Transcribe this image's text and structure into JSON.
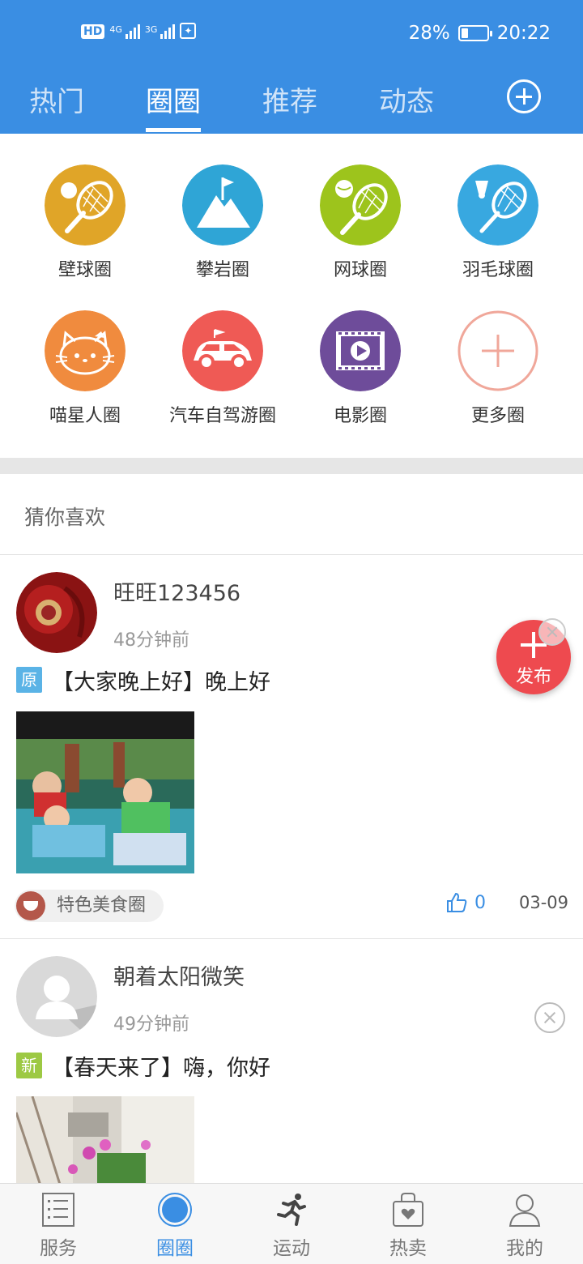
{
  "status_bar": {
    "hd": "HD",
    "net1": "4G",
    "net2": "3G",
    "battery": "28%",
    "battery_level": 0.28,
    "time": "20:22"
  },
  "top_tabs": [
    {
      "label": "热门",
      "active": false
    },
    {
      "label": "圈圈",
      "active": true
    },
    {
      "label": "推荐",
      "active": false
    },
    {
      "label": "动态",
      "active": false
    }
  ],
  "circles": [
    {
      "label": "壁球圈",
      "icon": "squash-racket-icon",
      "color": "#e0a528"
    },
    {
      "label": "攀岩圈",
      "icon": "mountain-flag-icon",
      "color": "#2fa5d6"
    },
    {
      "label": "网球圈",
      "icon": "tennis-racket-icon",
      "color": "#9dc41c"
    },
    {
      "label": "羽毛球圈",
      "icon": "badminton-racket-icon",
      "color": "#38a8e0"
    },
    {
      "label": "喵星人圈",
      "icon": "kitty-icon",
      "color": "#f08b3e"
    },
    {
      "label": "汽车自驾游圈",
      "icon": "car-icon",
      "color": "#ef5a55"
    },
    {
      "label": "电影圈",
      "icon": "film-play-icon",
      "color": "#6e4c9a"
    },
    {
      "label": "更多圈",
      "icon": "plus-circle-icon",
      "color": "#f0a79a"
    }
  ],
  "section_title": "猜你喜欢",
  "posts": [
    {
      "author": "旺旺123456",
      "time": "48分钟前",
      "tag": "原",
      "tag_color": "#5ab3e6",
      "title": "【大家晚上好】晚上好",
      "circle": "特色美食圈",
      "likes": "0",
      "date": "03-09"
    },
    {
      "author": "朝着太阳微笑",
      "time": "49分钟前",
      "tag": "新",
      "tag_color": "#9dc944",
      "title": "【春天来了】嗨，你好"
    }
  ],
  "fab": {
    "label": "发布",
    "color": "#ee4a4f"
  },
  "bottom_nav": [
    {
      "label": "服务",
      "icon": "list-icon",
      "active": false
    },
    {
      "label": "圈圈",
      "icon": "circle-icon",
      "active": true
    },
    {
      "label": "运动",
      "icon": "running-icon",
      "active": false
    },
    {
      "label": "热卖",
      "icon": "shopping-bag-icon",
      "active": false
    },
    {
      "label": "我的",
      "icon": "person-icon",
      "active": false
    }
  ],
  "colors": {
    "primary": "#3a8ee3",
    "accent": "#ee4a4f"
  }
}
